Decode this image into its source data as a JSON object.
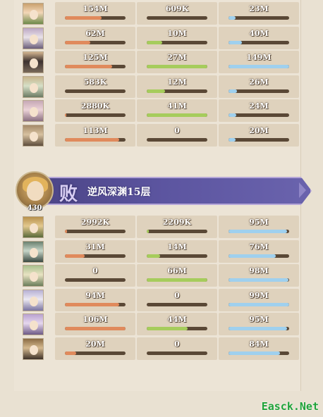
{
  "top_section": {
    "rows": [
      {
        "damage": "154M",
        "damage_fill": 0.6,
        "tank": "609K",
        "tank_fill": 0.0,
        "heal": "23M",
        "heal_fill": 0.12
      },
      {
        "damage": "62M",
        "damage_fill": 0.42,
        "tank": "10M",
        "tank_fill": 0.25,
        "heal": "40M",
        "heal_fill": 0.22
      },
      {
        "damage": "125M",
        "damage_fill": 0.78,
        "tank": "27M",
        "tank_fill": 1.0,
        "heal": "149M",
        "heal_fill": 1.0
      },
      {
        "damage": "583K",
        "damage_fill": 0.0,
        "tank": "12M",
        "tank_fill": 0.3,
        "heal": "26M",
        "heal_fill": 0.14
      },
      {
        "damage": "2880K",
        "damage_fill": 0.02,
        "tank": "41M",
        "tank_fill": 1.0,
        "heal": "24M",
        "heal_fill": 0.13
      },
      {
        "damage": "113M",
        "damage_fill": 0.9,
        "tank": "0",
        "tank_fill": 0.0,
        "heal": "20M",
        "heal_fill": 0.12
      }
    ]
  },
  "boss": {
    "level": "430",
    "result": "败",
    "stage": "逆风深渊15层"
  },
  "bottom_section": {
    "rows": [
      {
        "damage": "2992K",
        "damage_fill": 0.03,
        "tank": "2209K",
        "tank_fill": 0.03,
        "heal": "95M",
        "heal_fill": 0.97
      },
      {
        "damage": "31M",
        "damage_fill": 0.32,
        "tank": "14M",
        "tank_fill": 0.22,
        "heal": "76M",
        "heal_fill": 0.78
      },
      {
        "damage": "0",
        "damage_fill": 0.0,
        "tank": "66M",
        "tank_fill": 1.0,
        "heal": "98M",
        "heal_fill": 0.99
      },
      {
        "damage": "94M",
        "damage_fill": 0.89,
        "tank": "0",
        "tank_fill": 0.0,
        "heal": "99M",
        "heal_fill": 1.0
      },
      {
        "damage": "106M",
        "damage_fill": 1.0,
        "tank": "44M",
        "tank_fill": 0.67,
        "heal": "95M",
        "heal_fill": 0.96
      },
      {
        "damage": "20M",
        "damage_fill": 0.19,
        "tank": "0",
        "tank_fill": 0.0,
        "heal": "84M",
        "heal_fill": 0.85
      }
    ]
  },
  "colors": {
    "damage": "#e08a5c",
    "tank": "#a6cc5c",
    "heal": "#9fd0ee",
    "banner": "#544d96"
  },
  "watermark": "Easck.Net"
}
